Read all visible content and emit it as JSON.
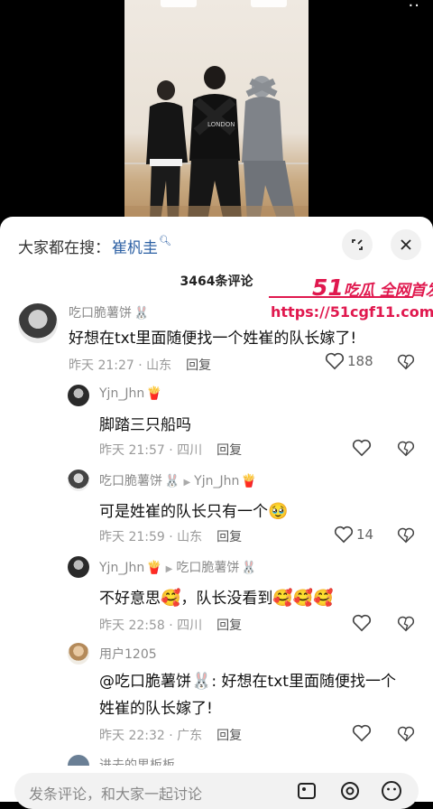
{
  "sheet": {
    "search_prefix": "大家都在搜：",
    "search_term": "崔杋圭",
    "comment_count": "3464条评论"
  },
  "watermark": {
    "brand_num": "51",
    "brand_text": "吃瓜 全网首发",
    "url": "https://51cgf11.com"
  },
  "comments": [
    {
      "user": "吃口脆薯饼",
      "badge": "🐰",
      "text": "好想在txt里面随便找一个姓崔的队长嫁了!",
      "time": "昨天 21:27 · 山东",
      "reply_label": "回复",
      "likes": "188"
    },
    {
      "user": "Yjn_Jhn",
      "badge": "🍟",
      "text": "脚踏三只船吗",
      "time": "昨天 21:57 · 四川",
      "reply_label": "回复",
      "likes": ""
    },
    {
      "user": "吃口脆薯饼",
      "badge": "🐰",
      "reply_to": "Yjn_Jhn",
      "reply_to_badge": "🍟",
      "text": "可是姓崔的队长只有一个",
      "emoji": "🥹",
      "time": "昨天 21:59 · 山东",
      "reply_label": "回复",
      "likes": "14"
    },
    {
      "user": "Yjn_Jhn",
      "badge": "🍟",
      "reply_to": "吃口脆薯饼",
      "reply_to_badge": "🐰",
      "text_a": "不好意思",
      "text_b": "，队长没看到",
      "emoji": "🥰",
      "emoji_tail": "🥰🥰🥰",
      "time": "昨天 22:58 · 四川",
      "reply_label": "回复",
      "likes": ""
    },
    {
      "user": "用户1205",
      "mention": "@吃口脆薯饼",
      "mention_badge": "🐰",
      "text_line1": ": 好想在txt里面随便找一个",
      "text_line2": "姓崔的队长嫁了!",
      "time": "昨天 22:32 · 广东",
      "reply_label": "回复",
      "likes": ""
    }
  ],
  "next_user_partial": "进去的男板板",
  "input": {
    "placeholder": "发条评论，和大家一起讨论"
  },
  "icons": [
    "minimize-icon",
    "close-icon",
    "heart-icon",
    "dislike-heart-icon",
    "image-icon",
    "at-icon",
    "emoji-icon"
  ]
}
